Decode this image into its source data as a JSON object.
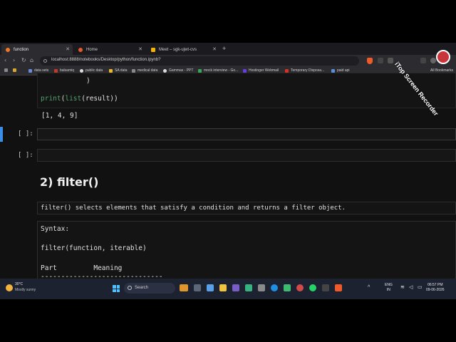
{
  "browser": {
    "tabs": [
      {
        "label": "function",
        "active": true,
        "favicon_color": "#f37726"
      },
      {
        "label": "Home",
        "active": false,
        "favicon_color": "#e55b2a"
      },
      {
        "label": "Meet – sgk-ujwt-cvs",
        "active": false,
        "favicon_color": "#f4b400"
      }
    ],
    "new_tab": "+",
    "url": "localhost:8888/notebooks/Desktop/python/function.ipynb?",
    "bookmarks": [
      {
        "label": "data sets",
        "color": "#6a8bd6"
      },
      {
        "label": "balsamiq",
        "color": "#c1392b"
      },
      {
        "label": "public data",
        "color": "#dddddd"
      },
      {
        "label": "SA data",
        "color": "#e8b830"
      },
      {
        "label": "medical data",
        "color": "#888888"
      },
      {
        "label": "Gammas - PPT",
        "color": "#dddddd"
      },
      {
        "label": "mock interview - Go...",
        "color": "#3aa757"
      },
      {
        "label": "Hostinger Webmail",
        "color": "#673de6"
      },
      {
        "label": "Temporary Disposa...",
        "color": "#d93025"
      },
      {
        "label": "paid api",
        "color": "#5b8dd9"
      }
    ],
    "all_bookmarks": "All Bookmarks"
  },
  "notebook": {
    "code_close_paren": ")",
    "print_fn": "print",
    "list_fn": "list",
    "print_arg": "result",
    "output": "[1, 4, 9]",
    "empty_prompt": "[ ]:",
    "heading": "2) filter()",
    "filter_desc": "filter() selects elements that satisfy a condition and returns a filter object.",
    "syntax_lines": [
      "Syntax:",
      "",
      "filter(function, iterable)",
      "",
      "Part         Meaning",
      "------------------------------"
    ]
  },
  "taskbar": {
    "weather_temp": "30°C",
    "weather_desc": "Mostly sunny",
    "search_label": "Search",
    "lang_top": "ENG",
    "lang_bottom": "IN",
    "time": "06:57 PM",
    "date": "09-06-2026"
  },
  "watermark": "iTop Screen Recorder",
  "colors": {
    "accent_blue": "#3b8ee8",
    "brave_orange": "#f05a28",
    "code_green": "#4ea36b"
  }
}
